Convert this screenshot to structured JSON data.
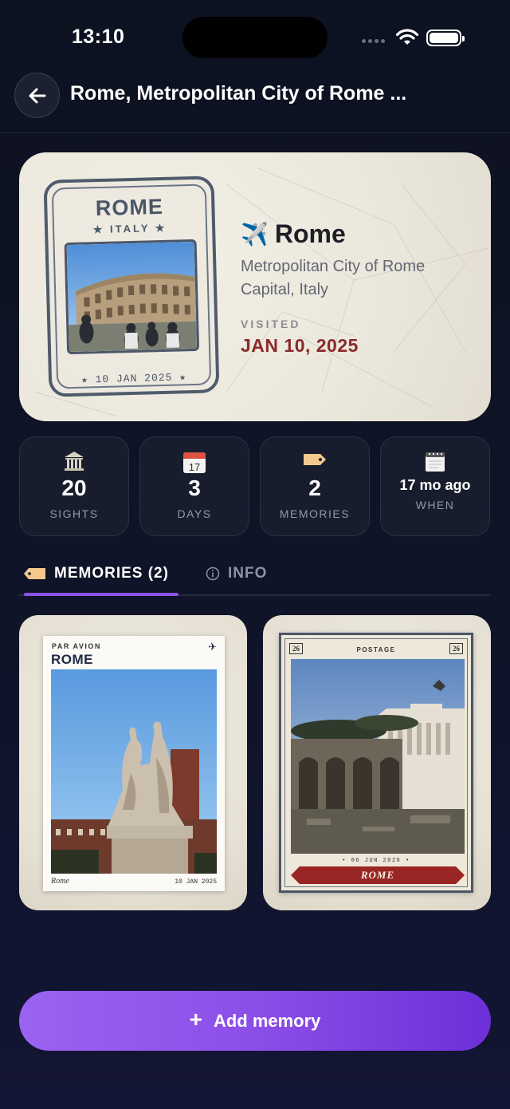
{
  "status_bar": {
    "time": "13:10"
  },
  "header": {
    "title": "Rome, Metropolitan City of Rome ..."
  },
  "hero": {
    "stamp_title": "ROME",
    "stamp_country": "★ ITALY ★",
    "stamp_date": "★ 10 JAN 2025 ★",
    "city_emoji": "✈️",
    "city": "Rome",
    "subtitle": "Metropolitan City of Rome Capital, Italy",
    "visited_label": "VISITED",
    "visited_date": "JAN 10, 2025"
  },
  "stats": [
    {
      "icon": "museum-icon",
      "value": "20",
      "label": "SIGHTS"
    },
    {
      "icon": "calendar-icon",
      "icon_text": "17",
      "value": "3",
      "label": "DAYS"
    },
    {
      "icon": "tag-icon",
      "value": "2",
      "label": "MEMORIES"
    },
    {
      "icon": "tear-off-calendar-icon",
      "value": "17 mo ago",
      "label": "WHEN"
    }
  ],
  "tabs": {
    "memories": "MEMORIES (2)",
    "info": "INFO",
    "active": "memories"
  },
  "memories": [
    {
      "style": "postcard",
      "header": "PAR AVION",
      "city": "ROME",
      "caption": "Rome",
      "date": "10 JAN 2025"
    },
    {
      "style": "stamp",
      "number_left": "26",
      "number_right": "26",
      "header": "POSTAGE",
      "date": "• 06 JUN 2026 •",
      "banner": "ROME"
    }
  ],
  "add_button": {
    "label": "Add memory",
    "icon": "+"
  },
  "colors": {
    "accent": "#8a53e6",
    "visited_date": "#8b2a2a",
    "card_bg": "#171d2c"
  }
}
